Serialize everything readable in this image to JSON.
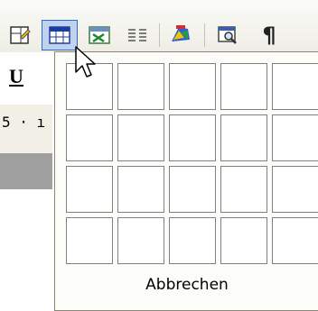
{
  "toolbar": {
    "buttons": [
      {
        "icon": "insert-frame-icon"
      },
      {
        "icon": "insert-table-icon"
      },
      {
        "icon": "insert-excel-icon"
      },
      {
        "icon": "columns-icon"
      },
      {
        "icon": "drawing-icon"
      },
      {
        "icon": "zoom-preview-icon"
      },
      {
        "icon": "paragraph-mark-icon",
        "glyph": "¶"
      }
    ],
    "underline_label": "U"
  },
  "ruler": {
    "text": "5 · ı"
  },
  "table_picker": {
    "rows": 4,
    "columns": 5,
    "cancel_label": "Abbrechen"
  },
  "colors": {
    "active_button_bg": "#c1d2ee",
    "active_button_border": "#316ac5"
  }
}
